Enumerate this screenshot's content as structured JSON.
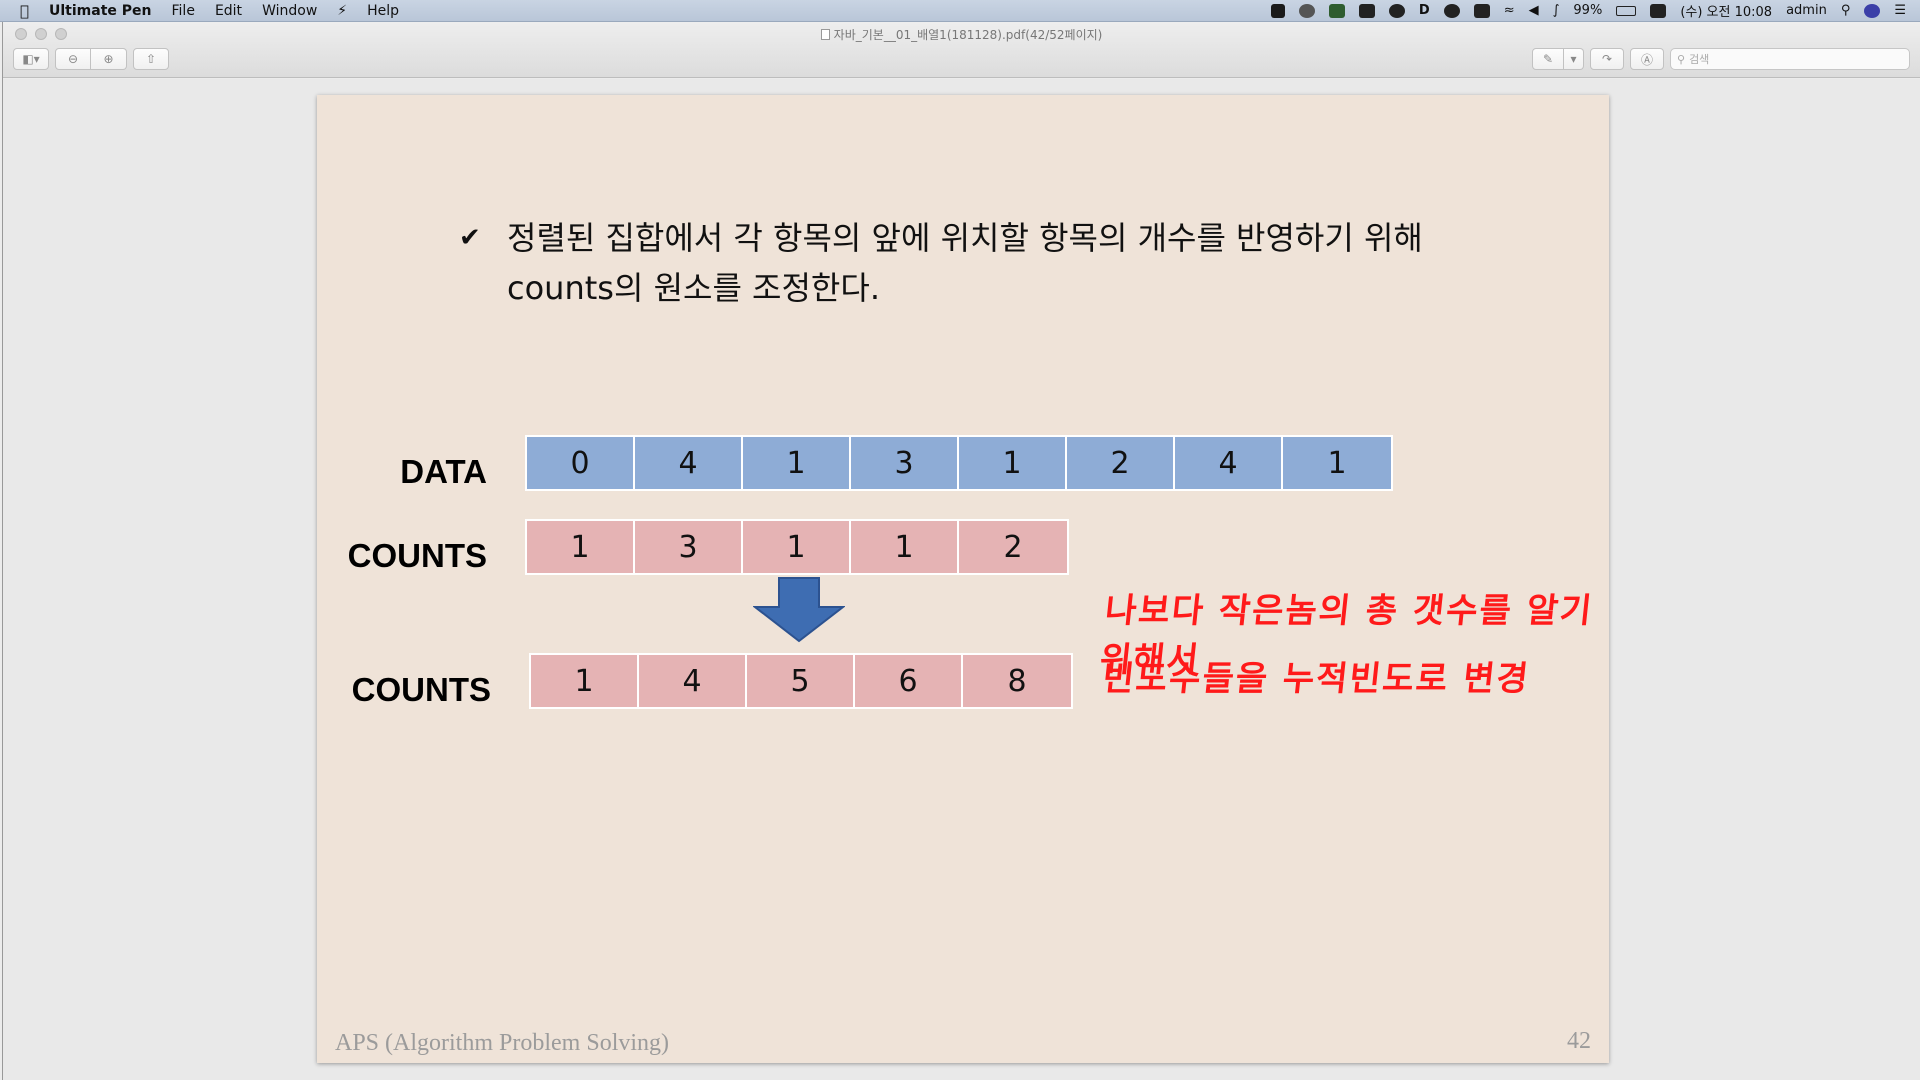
{
  "menubar": {
    "app_name": "Ultimate Pen",
    "menus": [
      "File",
      "Edit",
      "Window",
      "Help"
    ],
    "battery": "99%",
    "clock": "(수) 오전 10:08",
    "user": "admin"
  },
  "window": {
    "title": "자바_기본__01_배열1(181128).pdf(42/52페이지)",
    "search_placeholder": "검색"
  },
  "slide": {
    "bullet_line1": "정렬된 집합에서 각 항목의 앞에 위치할 항목의 개수를 반영하기 위해",
    "bullet_line2": "counts의 원소를 조정한다.",
    "data_label": "DATA",
    "data_values": [
      "0",
      "4",
      "1",
      "3",
      "1",
      "2",
      "4",
      "1"
    ],
    "counts_label": "COUNTS",
    "counts_values": [
      "1",
      "3",
      "1",
      "1",
      "2"
    ],
    "counts2_label": "COUNTS",
    "counts2_values": [
      "1",
      "4",
      "5",
      "6",
      "8"
    ],
    "annotation_line1": "나보다 작은놈의 총 갯수를 알기 위해서",
    "annotation_line2": "빈도수들을 누적빈도로 변경",
    "footer_left": "APS (Algorithm Problem Solving)",
    "page_number": "42",
    "colors": {
      "data_cell": "#8eacd6",
      "counts_cell": "#e5b3b4",
      "arrow": "#3e6db2",
      "annotation": "#ff1a1a",
      "slide_bg": "#efe3d8"
    }
  }
}
